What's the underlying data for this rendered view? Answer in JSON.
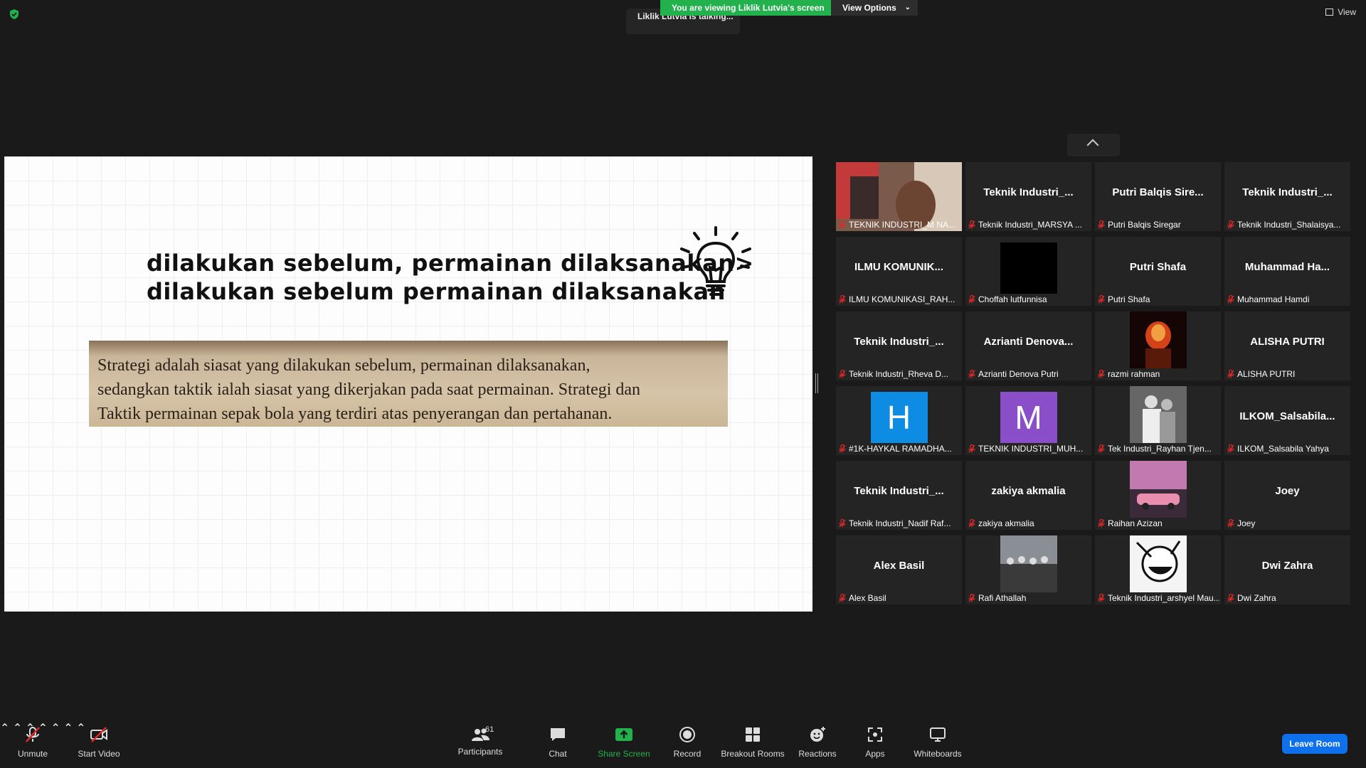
{
  "top": {
    "viewing_banner": "You are viewing Liklik Lutvia's screen",
    "view_options": "View Options",
    "talking": "Liklik Lutvia is talking...",
    "view": "View"
  },
  "slide": {
    "line1": "dilakukan sebelum, permainan dilaksanakan>",
    "line2": "dilakukan sebelum permainan dilaksanakan",
    "book_line1": "Strategi adalah siasat yang dilakukan sebelum, permainan dilaksanakan,",
    "book_line2": "sedangkan taktik ialah siasat yang dikerjakan pada saat permainan. Strategi dan",
    "book_line3": "Taktik permainan sepak bola yang terdiri atas penyerangan dan pertahanan."
  },
  "participants": [
    {
      "big": "",
      "label": "TEKNIK INDUSTRI_M NA...",
      "media": "video"
    },
    {
      "big": "Teknik Industri_...",
      "label": "Teknik Industri_MARSYA ...",
      "media": "none"
    },
    {
      "big": "Putri Balqis Sire...",
      "label": "Putri Balqis Siregar",
      "media": "none"
    },
    {
      "big": "Teknik Industri_...",
      "label": "Teknik Industri_Shalaisya...",
      "media": "none"
    },
    {
      "big": "ILMU KOMUNIK...",
      "label": "ILMU KOMUNIKASI_RAH...",
      "media": "none"
    },
    {
      "big": "",
      "label": "Choffah lutfunnisa",
      "media": "black"
    },
    {
      "big": "Putri Shafa",
      "label": "Putri Shafa",
      "media": "none"
    },
    {
      "big": "Muhammad Ha...",
      "label": "Muhammad Hamdi",
      "media": "none"
    },
    {
      "big": "Teknik Industri_...",
      "label": "Teknik Industri_Rheva D...",
      "media": "none"
    },
    {
      "big": "Azrianti Denova...",
      "label": "Azrianti Denova Putri",
      "media": "none"
    },
    {
      "big": "",
      "label": "razmi rahman",
      "media": "fire"
    },
    {
      "big": "ALISHA PUTRI",
      "label": "ALISHA PUTRI",
      "media": "none"
    },
    {
      "big": "H",
      "label": "#1K-HAYKAL RAMADHA...",
      "media": "letter-blue"
    },
    {
      "big": "M",
      "label": "TEKNIK INDUSTRI_MUH...",
      "media": "letter-purple"
    },
    {
      "big": "",
      "label": "Tek Industri_Rayhan Tjen...",
      "media": "photo-bw"
    },
    {
      "big": "ILKOM_Salsabila...",
      "label": "ILKOM_Salsabila Yahya",
      "media": "none"
    },
    {
      "big": "Teknik Industri_...",
      "label": "Teknik Industri_Nadif Raf...",
      "media": "none"
    },
    {
      "big": "zakiya akmalia",
      "label": "zakiya akmalia",
      "media": "none"
    },
    {
      "big": "",
      "label": "Raihan Azizan",
      "media": "car"
    },
    {
      "big": "Joey",
      "label": "Joey",
      "media": "none"
    },
    {
      "big": "Alex Basil",
      "label": "Alex Basil",
      "media": "none"
    },
    {
      "big": "",
      "label": "Rafi Athallah",
      "media": "group"
    },
    {
      "big": "",
      "label": "Teknik Industri_arshyel Mau...",
      "media": "manga"
    },
    {
      "big": "Dwi Zahra",
      "label": "Dwi Zahra",
      "media": "none"
    }
  ],
  "toolbar": {
    "unmute": "Unmute",
    "start_video": "Start Video",
    "participants": "Participants",
    "participants_count": "61",
    "chat": "Chat",
    "share_screen": "Share Screen",
    "record": "Record",
    "breakout_rooms": "Breakout Rooms",
    "reactions": "Reactions",
    "apps": "Apps",
    "whiteboards": "Whiteboards",
    "leave_room": "Leave Room"
  },
  "colors": {
    "banner_green": "#22b14c",
    "leave_blue": "#0e71eb",
    "share_green": "#22b14c",
    "mic_off_red": "#e02828"
  }
}
